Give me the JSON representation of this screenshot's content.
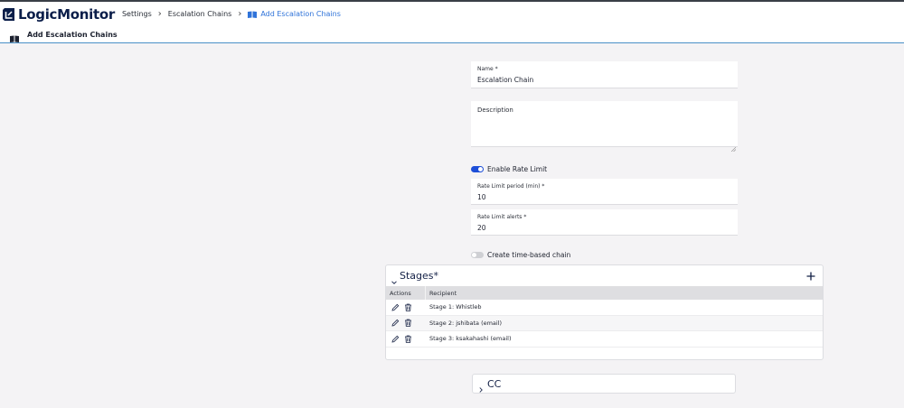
{
  "app": {
    "logo_text": "LogicMonitor",
    "breadcrumb": [
      "Settings",
      "Escalation Chains",
      "Add Escalation Chains"
    ]
  },
  "page": {
    "title": "Add Escalation Chains"
  },
  "form": {
    "name": {
      "label": "Name *",
      "value": "Escalation Chain"
    },
    "description": {
      "label": "Description",
      "value": ""
    },
    "rate_limit_toggle": {
      "label": "Enable Rate Limit",
      "on": true
    },
    "rate_limit_period": {
      "label": "Rate Limit period (min) *",
      "value": "10"
    },
    "rate_limit_alerts": {
      "label": "Rate Limit alerts *",
      "value": "20"
    },
    "time_based_toggle": {
      "label": "Create time-based chain",
      "on": false
    }
  },
  "stages": {
    "title": "Stages*",
    "columns": [
      "Actions",
      "Recipient"
    ],
    "rows": [
      {
        "recipient": "Stage 1: Whistleb"
      },
      {
        "recipient": "Stage 2: jshibata (email)"
      },
      {
        "recipient": "Stage 3: ksakahashi (email)"
      }
    ]
  },
  "cc": {
    "title": "CC"
  },
  "colors": {
    "accent": "#2f73d9",
    "toggle_on": "#1d4ed8",
    "brand_dark": "#0b1e4a"
  },
  "icons": [
    "logo-icon",
    "chevron-right-icon",
    "book-icon",
    "chevron-down-icon",
    "plus-icon",
    "pencil-icon",
    "trash-icon"
  ]
}
